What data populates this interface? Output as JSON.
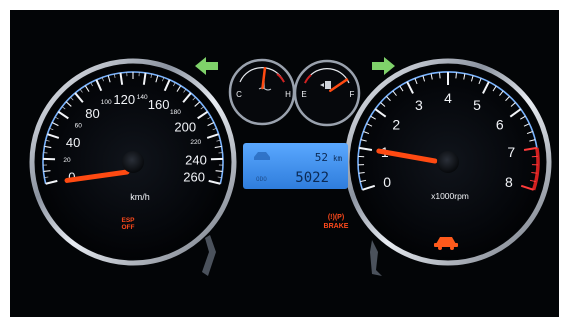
{
  "speedometer": {
    "major_labels": [
      "0",
      "20",
      "40",
      "60",
      "80",
      "100",
      "120",
      "140",
      "160",
      "180",
      "200",
      "220",
      "240",
      "260"
    ],
    "unit": "km/h",
    "needle_value": 0,
    "max_value": 260,
    "esp_line1": "ESP",
    "esp_line2": "OFF"
  },
  "tachometer": {
    "labels": [
      "0",
      "1",
      "2",
      "3",
      "4",
      "5",
      "6",
      "7",
      "8"
    ],
    "unit": "x1000rpm",
    "needle_value": 1,
    "redline_start": 7
  },
  "temperature_gauge": {
    "cold_label": "C",
    "hot_label": "H",
    "level": 0.55
  },
  "fuel_gauge": {
    "empty_label": "E",
    "full_label": "F",
    "level": 0.9
  },
  "odometer_display": {
    "trip_value": "52",
    "trip_unit": "km",
    "total_value": "5022"
  },
  "brake_warning": {
    "line1": "(!)(P)",
    "line2": "BRAKE"
  },
  "colors": {
    "indicator_green": "#7fd26a",
    "needle_orange": "#ff4a12",
    "warning_orange": "#ff4a1c",
    "lcd_blue": "#3d8fe6",
    "redline": "#d22020",
    "scale_blue": "#7ab4ff"
  },
  "icons": [
    "turn-left-arrow-icon",
    "turn-right-arrow-icon",
    "coolant-temperature-icon",
    "fuel-pump-icon",
    "car-warning-icon",
    "esp-off-icon",
    "brake-warning-icon"
  ]
}
